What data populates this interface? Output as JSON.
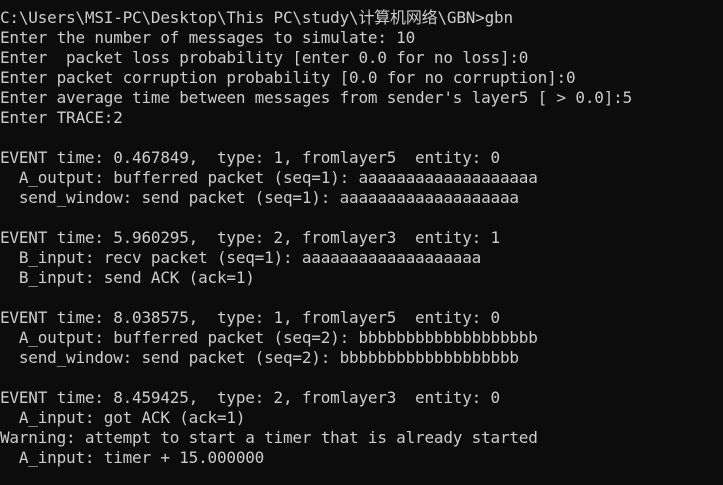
{
  "console": {
    "lines": [
      "C:\\Users\\MSI-PC\\Desktop\\This PC\\study\\计算机网络\\GBN>gbn",
      "Enter the number of messages to simulate: 10",
      "Enter  packet loss probability [enter 0.0 for no loss]:0",
      "Enter packet corruption probability [0.0 for no corruption]:0",
      "Enter average time between messages from sender's layer5 [ > 0.0]:5",
      "Enter TRACE:2",
      "",
      "EVENT time: 0.467849,  type: 1, fromlayer5  entity: 0",
      "  A_output: bufferred packet (seq=1): aaaaaaaaaaaaaaaaaaa",
      "  send_window: send packet (seq=1): aaaaaaaaaaaaaaaaaaa",
      "",
      "EVENT time: 5.960295,  type: 2, fromlayer3  entity: 1",
      "  B_input: recv packet (seq=1): aaaaaaaaaaaaaaaaaaa",
      "  B_input: send ACK (ack=1)",
      "",
      "EVENT time: 8.038575,  type: 1, fromlayer5  entity: 0",
      "  A_output: bufferred packet (seq=2): bbbbbbbbbbbbbbbbbbb",
      "  send_window: send packet (seq=2): bbbbbbbbbbbbbbbbbbb",
      "",
      "EVENT time: 8.459425,  type: 2, fromlayer3  entity: 0",
      "  A_input: got ACK (ack=1)",
      "Warning: attempt to start a timer that is already started",
      "  A_input: timer + 15.000000",
      ""
    ]
  }
}
